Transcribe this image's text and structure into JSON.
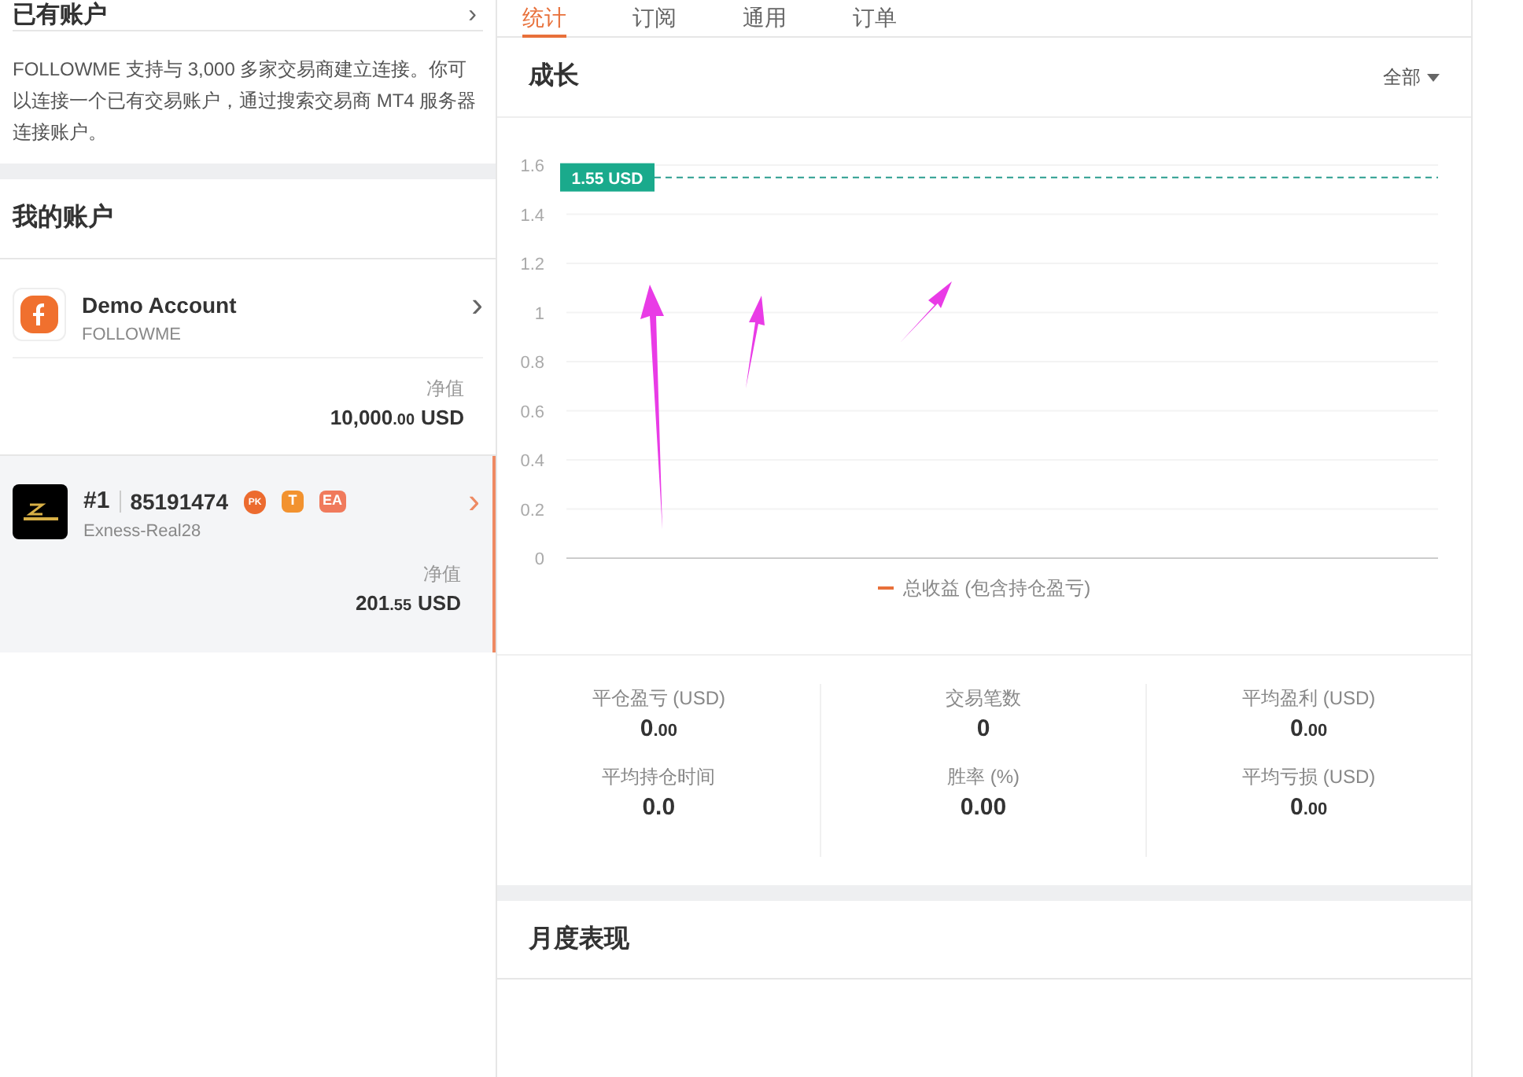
{
  "sidebar": {
    "existing_header": {
      "title": "已有账户",
      "chevron": "›"
    },
    "connect_note": "FOLLOWME 支持与 3,000 多家交易商建立连接。你可以连接一个已有交易账户，通过搜索交易商 MT4 服务器连接账户。",
    "my_accounts_title": "我的账户",
    "accounts": [
      {
        "kind": "demo",
        "name": "Demo Account",
        "broker": "FOLLOWME",
        "chevron": "›",
        "equity_label": "净值",
        "equity_int": "10,000",
        "equity_frac": ".00",
        "currency": "USD",
        "selected": false
      },
      {
        "kind": "real",
        "rank": "#1",
        "name": "85191474",
        "broker": "Exness-Real28",
        "chevron": "›",
        "equity_label": "净值",
        "equity_int": "201",
        "equity_frac": ".55",
        "currency": "USD",
        "badges": [
          {
            "kind": "fire",
            "label": "PK"
          },
          {
            "kind": "square",
            "label": "T"
          },
          {
            "kind": "square",
            "label": "EA"
          }
        ],
        "selected": true
      }
    ]
  },
  "tabs": [
    {
      "label": "统计",
      "selected": true
    },
    {
      "label": "订阅",
      "selected": false
    },
    {
      "label": "通用",
      "selected": false
    },
    {
      "label": "订单",
      "selected": false
    }
  ],
  "growth": {
    "title": "成长",
    "range_filter": "全部",
    "chart_data": {
      "type": "line",
      "grid": true,
      "ylim": [
        0,
        1.6
      ],
      "yticks": [
        0,
        0.2,
        0.4,
        0.6,
        0.8,
        1,
        1.2,
        1.4,
        1.6
      ],
      "series": [
        {
          "name": "总收益 (包含持仓盈亏)",
          "color": "#e8703a"
        }
      ],
      "ref_lines": [
        {
          "axis": "y",
          "value": 1.55,
          "label": "1.55 USD",
          "color": "#2a9d8f"
        }
      ]
    }
  },
  "stats": [
    {
      "label": "平仓盈亏 (USD)",
      "value_int": "0",
      "value_frac": ".00"
    },
    {
      "label": "交易笔数",
      "value_int": "0"
    },
    {
      "label": "平均盈利 (USD)",
      "value_int": "0",
      "value_frac": ".00"
    },
    {
      "label": "平均持仓时间",
      "value_int": "0.0"
    },
    {
      "label": "胜率 (%)",
      "value_int": "0.00"
    },
    {
      "label": "平均亏损 (USD)",
      "value_int": "0",
      "value_frac": ".00"
    }
  ],
  "monthly": {
    "title": "月度表现"
  }
}
